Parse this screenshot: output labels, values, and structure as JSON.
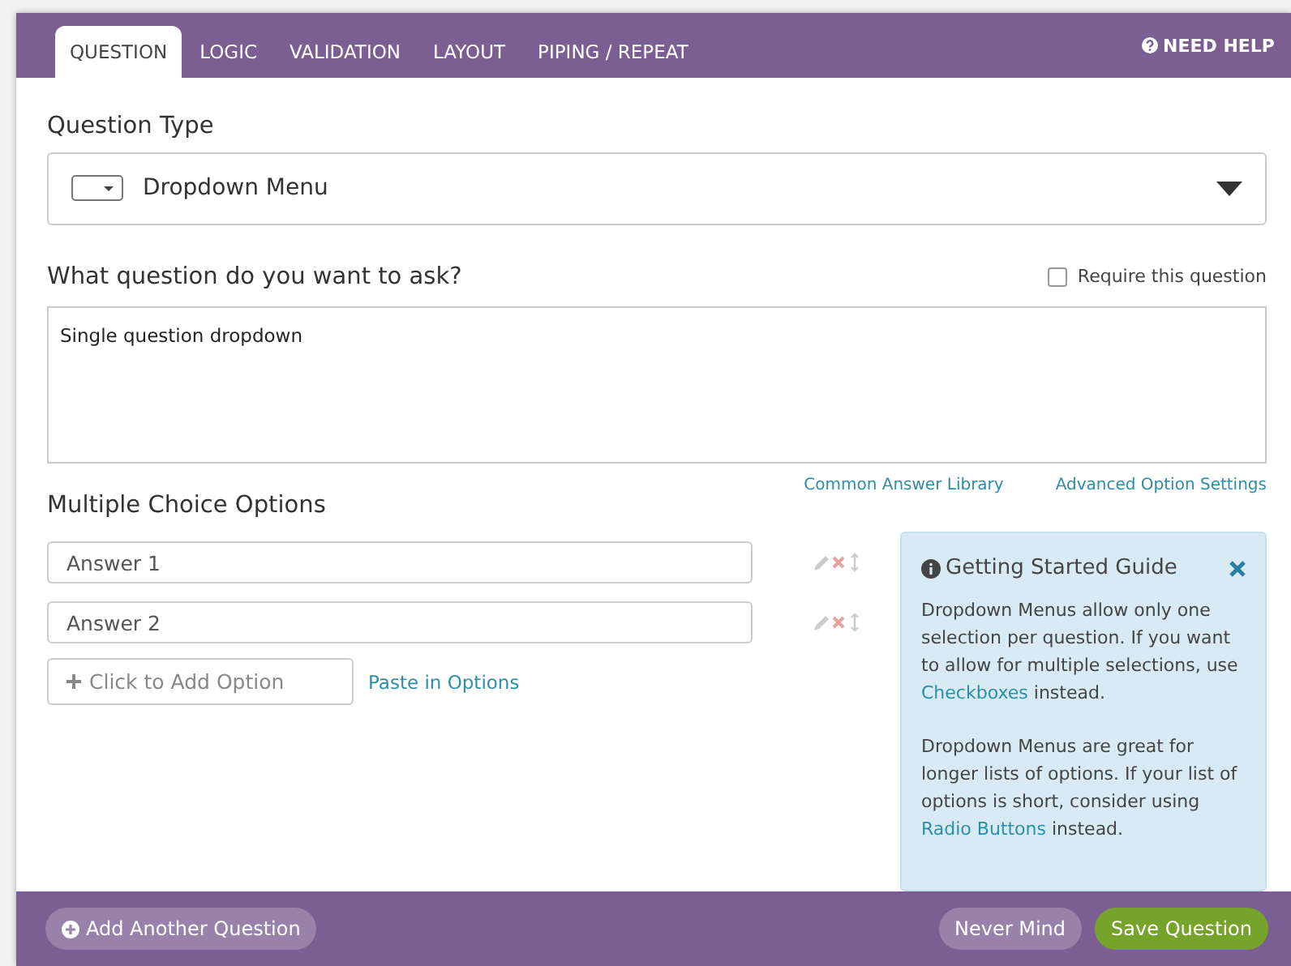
{
  "tabs": [
    {
      "label": "QUESTION",
      "selected": true
    },
    {
      "label": "LOGIC",
      "selected": false
    },
    {
      "label": "VALIDATION",
      "selected": false
    },
    {
      "label": "LAYOUT",
      "selected": false
    },
    {
      "label": "PIPING / REPEAT",
      "selected": false
    }
  ],
  "help_link": "NEED HELP",
  "question_type": {
    "label": "Question Type",
    "value": "Dropdown Menu"
  },
  "question": {
    "label": "What question do you want to ask?",
    "require_label": "Require this question",
    "required": false,
    "value": "Single question dropdown"
  },
  "links": [
    "Common Answer Library",
    "Advanced Option Settings"
  ],
  "options": {
    "label": "Multiple Choice Options",
    "answers": [
      "Answer 1",
      "Answer 2"
    ],
    "add_placeholder": "Click to Add Option",
    "paste_link": "Paste in Options"
  },
  "guide": {
    "title": "Getting Started Guide",
    "paragraphs": [
      {
        "before": "Dropdown Menus allow only one selection per question. If you want to allow for multiple selections, use ",
        "link": "Checkboxes",
        "after": " instead."
      },
      {
        "before": "Dropdown Menus are great for longer lists of options. If your list of options is short, consider using ",
        "link": "Radio Buttons",
        "after": " instead."
      }
    ]
  },
  "footer": {
    "add_button": "Add Another Question",
    "cancel_button": "Never Mind",
    "save_button": "Save Question"
  }
}
